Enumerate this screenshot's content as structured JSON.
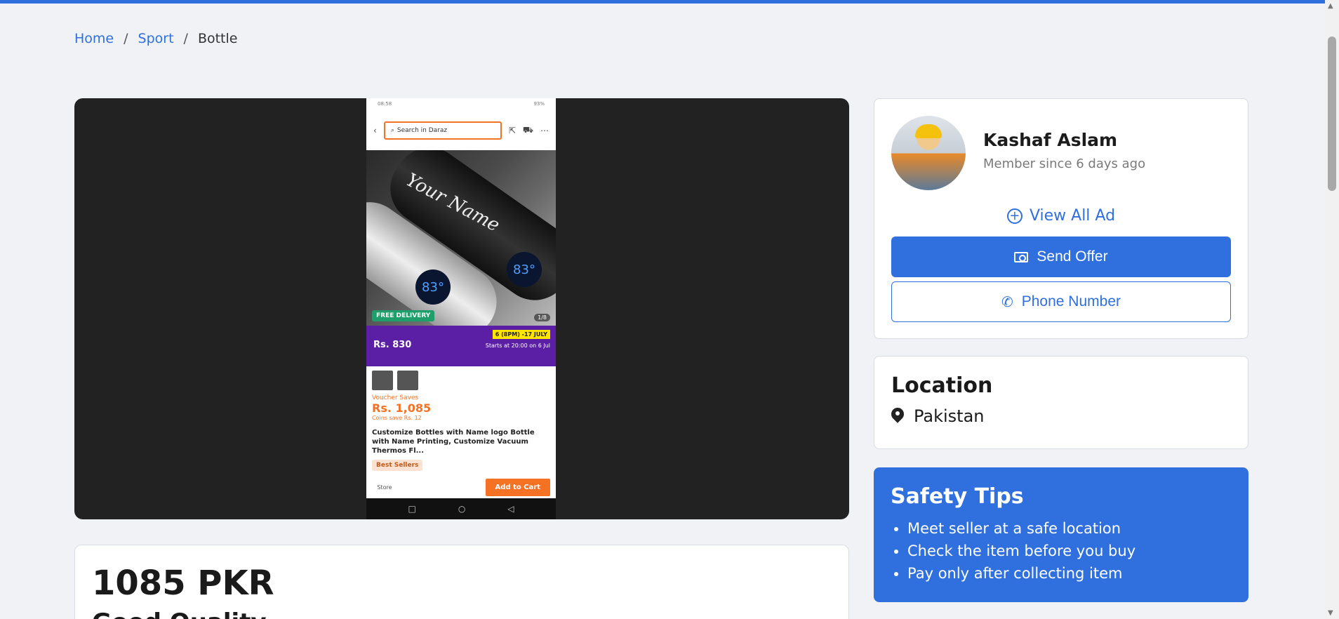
{
  "breadcrumb": {
    "home": "Home",
    "sport": "Sport",
    "current": "Bottle",
    "separator": "/"
  },
  "gallery": {
    "phone_status_time": "08:58",
    "phone_status_right": "93%",
    "search_placeholder": "Search in Daraz",
    "bottle_text": "Your Name",
    "temp_value": "83°",
    "badge": "FREE DELIVERY",
    "image_counter": "1/8",
    "promo_price": "Rs. 830",
    "promo_time": "6 (8PM) -17 JULY",
    "promo_starts": "Starts at 20:00 on 6 Jul",
    "voucher_text": "Voucher Saves",
    "product_price": "Rs. 1,085",
    "coins_text": "Coins save Rs. 12",
    "product_title": "Customize Bottles with Name logo Bottle with Name Printing, Customize Vacuum Thermos Fl...",
    "best_sellers": "Best Sellers",
    "store_label": "Store",
    "add_to_cart": "Add to Cart"
  },
  "listing": {
    "price": "1085 PKR",
    "title": "Good Quality"
  },
  "seller": {
    "name": "Kashaf Aslam",
    "since": "Member since 6 days ago",
    "view_all": "View All Ad",
    "send_offer": "Send Offer",
    "phone": "Phone Number"
  },
  "location": {
    "title": "Location",
    "value": "Pakistan"
  },
  "safety": {
    "title": "Safety Tips",
    "tips": [
      "Meet seller at a safe location",
      "Check the item before you buy",
      "Pay only after collecting item"
    ]
  },
  "colors": {
    "accent": "#2f6fde",
    "page_bg": "#f0f2f5",
    "gallery_bg": "#222222",
    "daraz_orange": "#f57224"
  }
}
